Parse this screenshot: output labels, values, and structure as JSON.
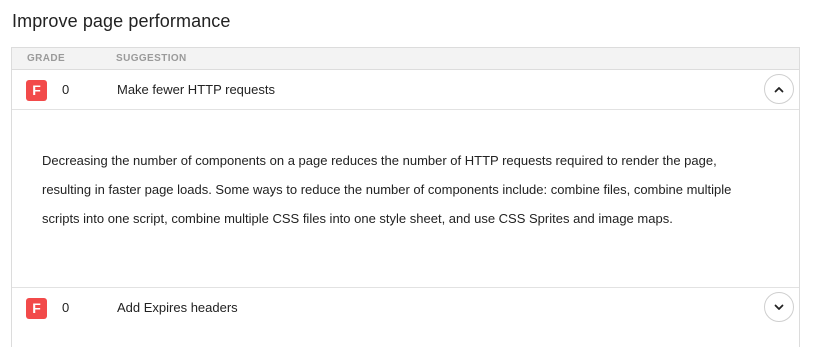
{
  "page": {
    "title": "Improve page performance"
  },
  "table": {
    "headers": {
      "grade": "GRADE",
      "suggestion": "SUGGESTION"
    },
    "rows": [
      {
        "grade": "F",
        "score": "0",
        "suggestion": "Make fewer HTTP requests",
        "expanded": true,
        "toggle_icon": "chevron-up-icon",
        "detail": "Decreasing the number of components on a page reduces the number of HTTP requests required to render the page, resulting in faster page loads. Some ways to reduce the number of components include: combine files, combine multiple scripts into one script, combine multiple CSS files into one style sheet, and use CSS Sprites and image maps."
      },
      {
        "grade": "F",
        "score": "0",
        "suggestion": "Add Expires headers",
        "expanded": false,
        "toggle_icon": "chevron-down-icon"
      }
    ]
  },
  "colors": {
    "grade_f": "#f24a4a",
    "header_bg": "#f3f3f3",
    "border": "#dcdcdc"
  }
}
